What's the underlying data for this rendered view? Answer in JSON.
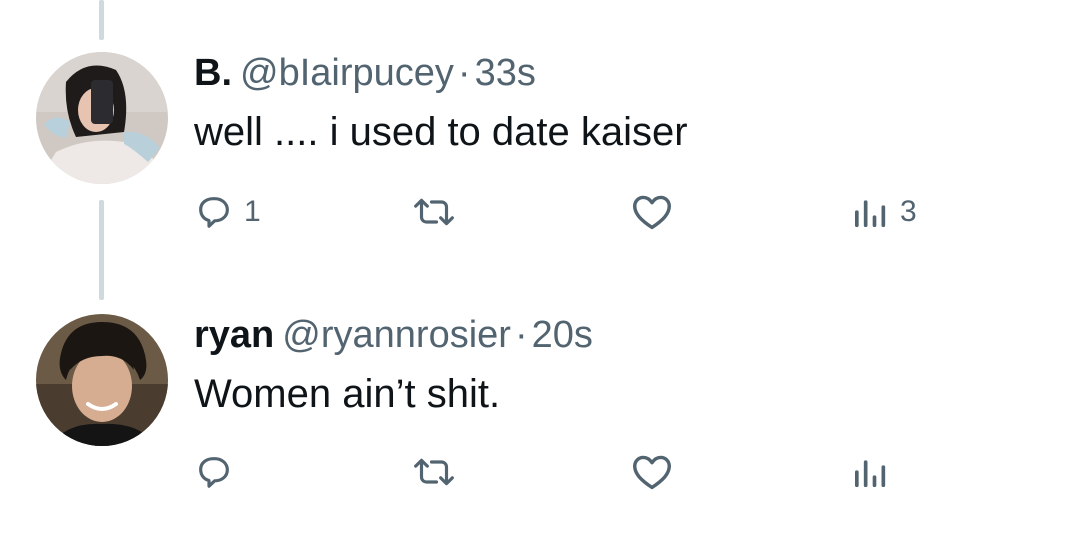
{
  "tweets": [
    {
      "display_name": "B.",
      "handle": "@bIairpucey",
      "separator": "·",
      "time": "33s",
      "text": "well .... i used to date kaiser",
      "actions": {
        "reply_count": "1",
        "retweet_count": "",
        "like_count": "",
        "views_count": "3"
      }
    },
    {
      "display_name": "ryan",
      "handle": "@ryannrosier",
      "separator": "·",
      "time": "20s",
      "text": "Women ain’t shit.",
      "actions": {
        "reply_count": "",
        "retweet_count": "",
        "like_count": "",
        "views_count": ""
      }
    }
  ],
  "colors": {
    "text_primary": "#0f1419",
    "text_secondary": "#536471",
    "thread_line": "#cfd9de",
    "background": "#ffffff"
  },
  "icons": {
    "reply": "reply-icon",
    "retweet": "retweet-icon",
    "like": "heart-icon",
    "views": "views-icon"
  }
}
